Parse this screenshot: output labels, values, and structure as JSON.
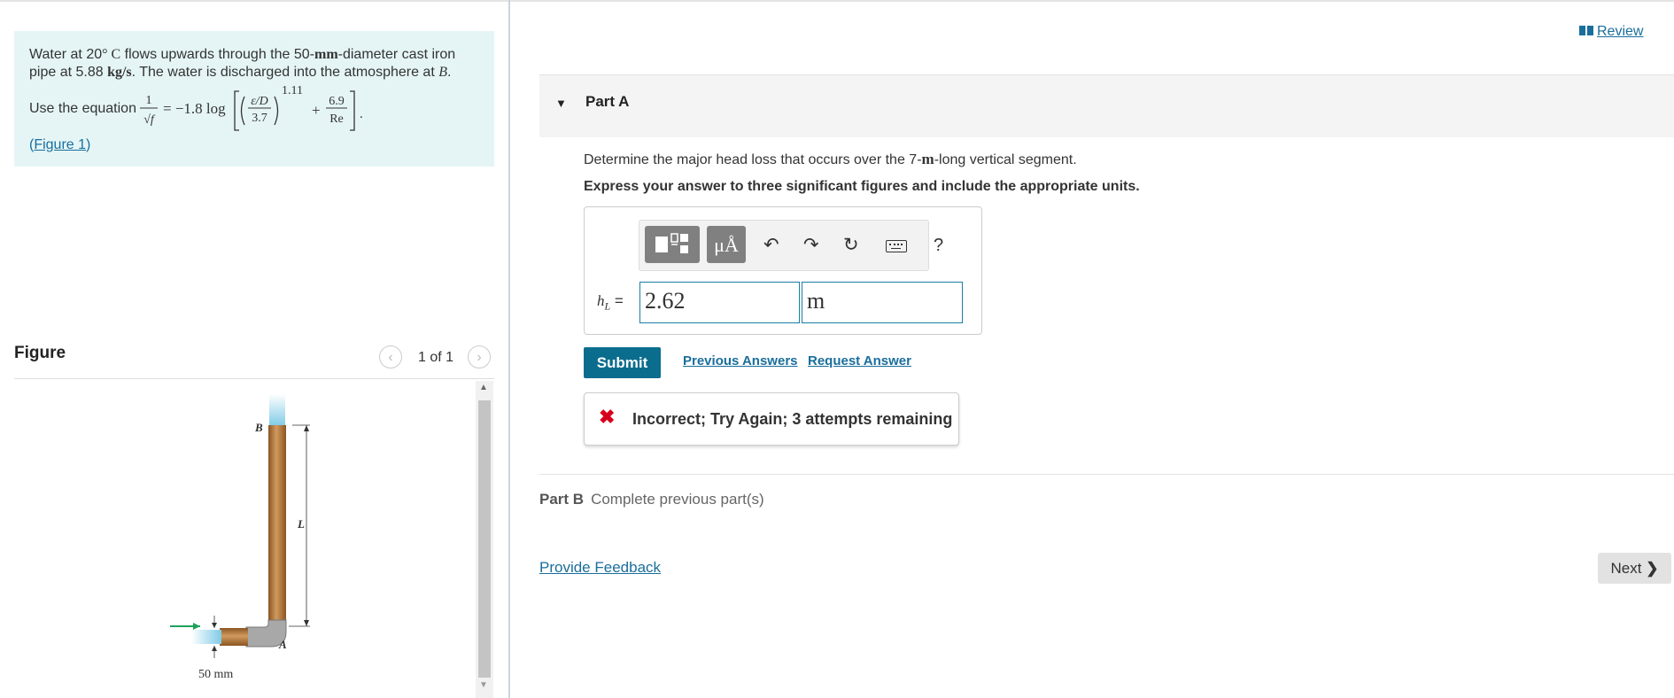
{
  "problem": {
    "text_line1_a": "Water at 20",
    "text_line1_b": "° C",
    "text_line1_c": " flows upwards through the 50-",
    "text_line1_mm": "mm",
    "text_line1_d": "-diameter cast iron",
    "text_line2_a": "pipe at 5.88 ",
    "text_line2_unit": "kg/s",
    "text_line2_b": ". The water is discharged into the atmosphere at ",
    "text_line2_B": "B",
    "text_line2_end": ".",
    "equation_label": "Use the equation",
    "equation": {
      "lhs_num": "1",
      "lhs_den": "√f",
      "coef": "= −1.8 log",
      "inner_num": "ε/D",
      "inner_den": "3.7",
      "exponent": "1.11",
      "plus": "+",
      "frac2_num": "6.9",
      "frac2_den": "Re",
      "end": "."
    },
    "figure_link_open": "(",
    "figure_link": "Figure 1",
    "figure_link_close": ")"
  },
  "figure": {
    "title": "Figure",
    "pager_text": "1 of 1",
    "prev_icon": "chevron-left-icon",
    "next_icon": "chevron-right-icon",
    "labels": {
      "B": "B",
      "L": "L",
      "A": "A",
      "diameter": "50 mm"
    },
    "colors": {
      "pipe": "#b7783a",
      "water": "#7fcbe6",
      "elbow": "#a8a8a8",
      "arrow": "#1fa25c"
    }
  },
  "review": {
    "icon": "book-icon",
    "label": "Review"
  },
  "partA": {
    "title": "Part A",
    "question_a": "Determine the major head loss that occurs over the 7-",
    "question_unit": "m",
    "question_b": "-long vertical segment.",
    "instruction": "Express your answer to three significant figures and include the appropriate units.",
    "toolbar": {
      "templates_icon": "templates-icon",
      "units_label": "μÅ",
      "undo_icon": "undo-icon",
      "redo_icon": "redo-icon",
      "reset_icon": "reset-icon",
      "keyboard_icon": "keyboard-icon",
      "help_label": "?"
    },
    "answer_label": "h",
    "answer_label_sub": "L",
    "answer_equals": "=",
    "answer_value": "2.62",
    "answer_unit": "m",
    "submit_label": "Submit",
    "previous_answers": "Previous Answers",
    "request_answer": "Request Answer",
    "feedback_icon": "x-icon",
    "feedback_symbol": "✖",
    "feedback_text": "Incorrect; Try Again; 3 attempts remaining"
  },
  "partB": {
    "title": "Part B",
    "status": "Complete previous part(s)"
  },
  "footer": {
    "provide_feedback": "Provide Feedback",
    "next_label": "Next"
  }
}
